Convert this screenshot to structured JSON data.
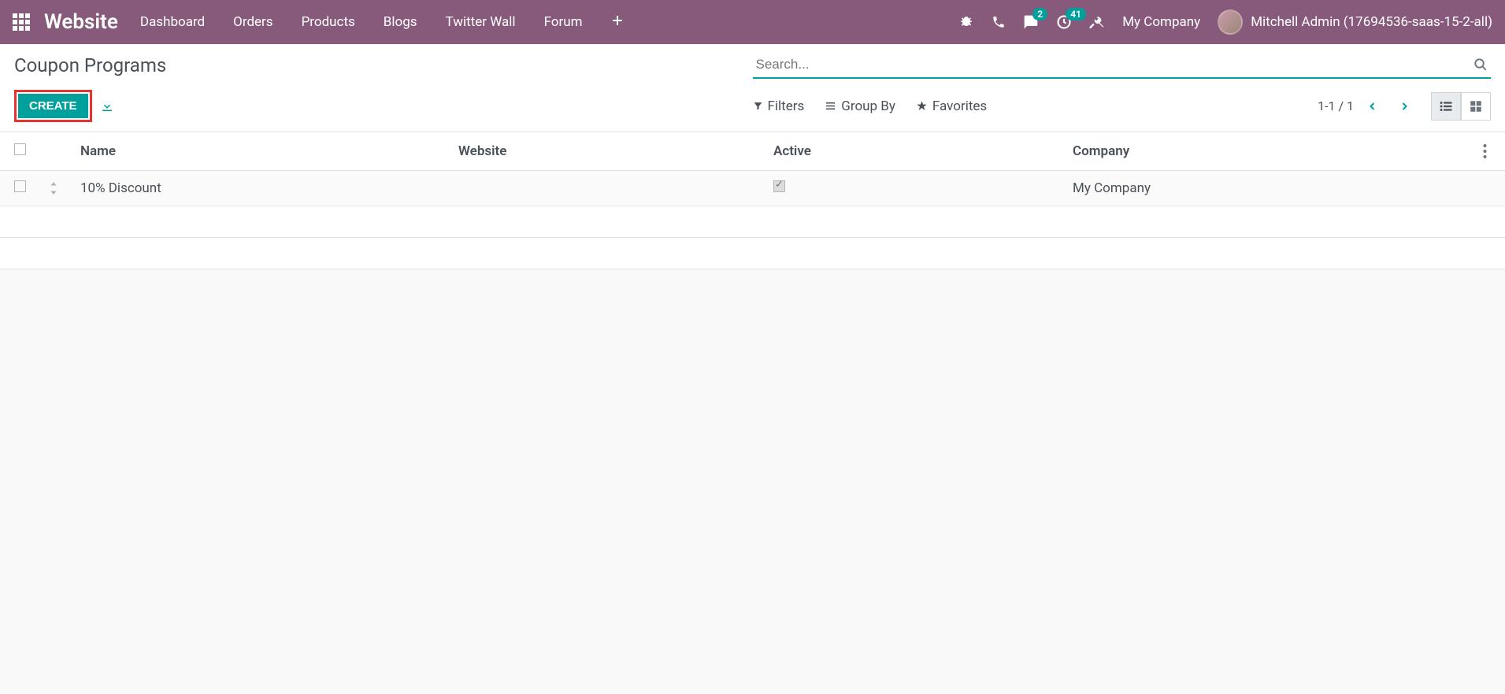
{
  "topnav": {
    "brand": "Website",
    "links": [
      "Dashboard",
      "Orders",
      "Products",
      "Blogs",
      "Twitter Wall",
      "Forum"
    ],
    "messaging_badge": "2",
    "activity_badge": "41",
    "company": "My Company",
    "user": "Mitchell Admin (17694536-saas-15-2-all)"
  },
  "control_panel": {
    "title": "Coupon Programs",
    "search_placeholder": "Search...",
    "create_label": "CREATE",
    "filters_label": "Filters",
    "groupby_label": "Group By",
    "favorites_label": "Favorites",
    "pager": "1-1 / 1"
  },
  "table": {
    "headers": {
      "name": "Name",
      "website": "Website",
      "active": "Active",
      "company": "Company"
    },
    "rows": [
      {
        "name": "10% Discount",
        "website": "",
        "active": true,
        "company": "My Company"
      }
    ]
  }
}
